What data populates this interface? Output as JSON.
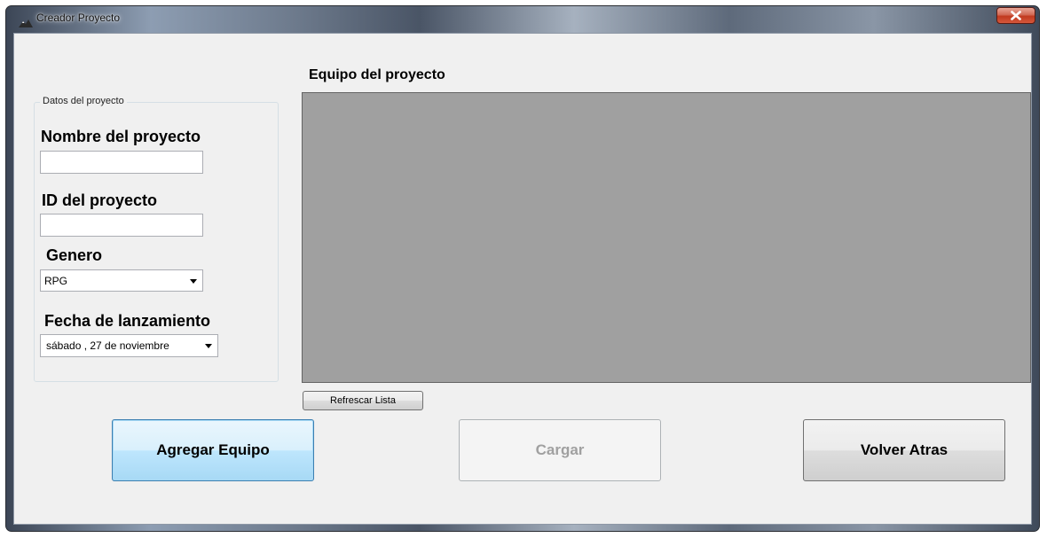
{
  "window": {
    "title": "Creador Proyecto"
  },
  "project_data": {
    "group_title": "Datos del proyecto",
    "name_label": "Nombre del proyecto",
    "name_value": "",
    "id_label": "ID del proyecto",
    "id_value": "",
    "genre_label": "Genero",
    "genre_value": "RPG",
    "release_label": "Fecha de lanzamiento",
    "release_value": "sábado   , 27 de noviembre"
  },
  "team": {
    "title": "Equipo del proyecto",
    "refresh_label": "Refrescar Lista"
  },
  "actions": {
    "add_team_label": "Agregar Equipo",
    "load_label": "Cargar",
    "back_label": "Volver Atras"
  },
  "colors": {
    "list_background": "#a0a0a0",
    "client_background": "#f0f0f0",
    "close_button": "#c13a1f"
  }
}
